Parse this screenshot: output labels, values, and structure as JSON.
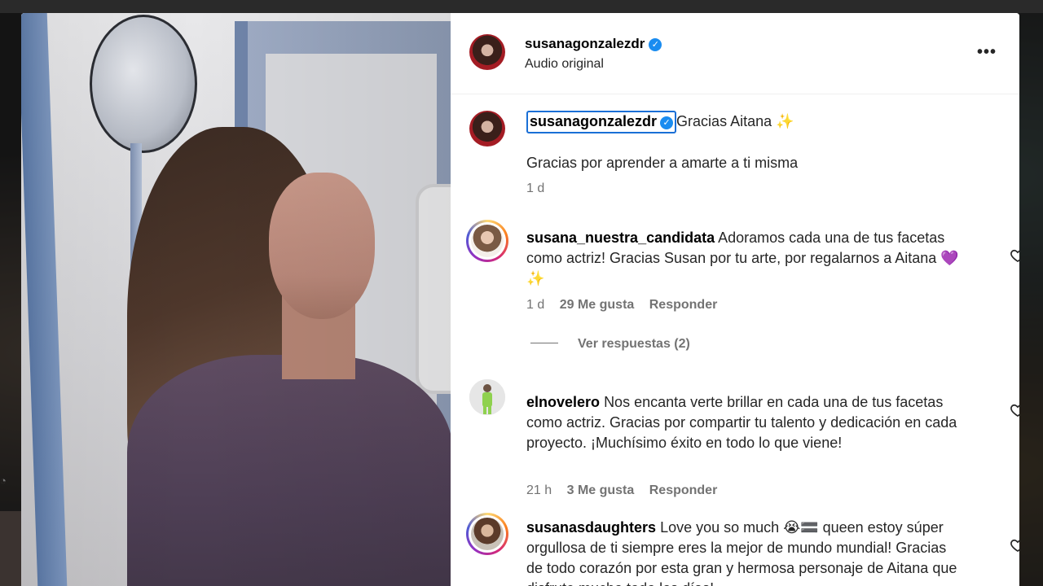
{
  "post": {
    "username": "susanagonzalezdr",
    "audio": "Audio original",
    "more_label": "•••"
  },
  "caption": {
    "username": "susanagonzalezdr",
    "title": "Gracias Aitana ✨",
    "text": "Gracias por aprender a amarte a ti misma",
    "time": "1 d"
  },
  "comments": [
    {
      "username": "susana_nuestra_candidata",
      "text": "Adoramos cada una de tus facetas como actriz! Gracias Susan por tu arte, por regalarnos a Aitana 💜✨",
      "time": "1 d",
      "likes": "29 Me gusta",
      "reply": "Responder",
      "view_replies": "Ver respuestas (2)"
    },
    {
      "username": "elnovelero",
      "text": "Nos encanta verte brillar en cada una de tus facetas como actriz. Gracias por compartir tu talento y dedicación en cada proyecto. ¡Muchísimo éxito en todo lo que viene!",
      "time": "21 h",
      "likes": "3 Me gusta",
      "reply": "Responder"
    },
    {
      "username": "susanasdaughters",
      "text": "Love you so much 😭🟰 queen estoy súper orgullosa de ti siempre eres la mejor de mundo mundial! Gracias de todo corazón por esta gran y hermosa personaje de Aitana que disfrute mucho todo los días!",
      "time": "",
      "likes": "",
      "reply": ""
    }
  ],
  "colors": {
    "verified": "#1a8cf0",
    "secondary_text": "#737373",
    "focus_outline": "#1a6fd6"
  },
  "icons": [
    "verified-badge-icon",
    "more-options-icon",
    "heart-icon"
  ]
}
